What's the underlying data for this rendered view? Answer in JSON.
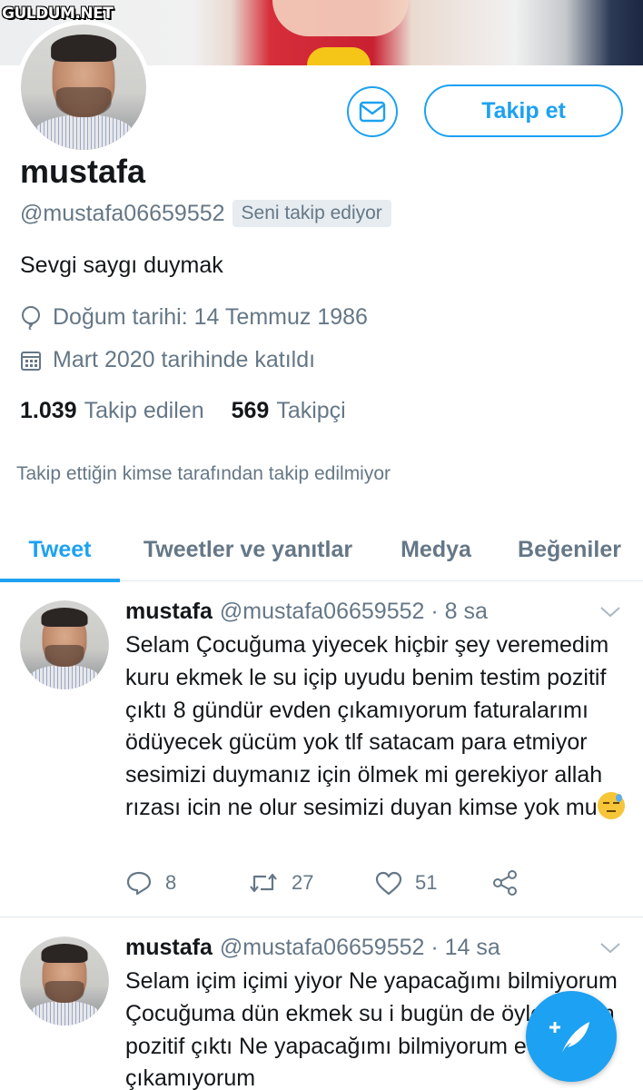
{
  "watermark": "GULDUM.NET",
  "profile": {
    "name": "mustafa",
    "handle": "@mustafa06659552",
    "follows_you": "Seni takip ediyor",
    "bio": "Sevgi saygı duymak",
    "birth": "Doğum tarihi: 14 Temmuz 1986",
    "joined": "Mart 2020 tarihinde katıldı",
    "following_count": "1.039",
    "following_label": "Takip edilen",
    "followers_count": "569",
    "followers_label": "Takipçi",
    "not_followed_note": "Takip ettiğin kimse tarafından takip edilmiyor",
    "follow_button": "Takip et",
    "message_icon": "mail-icon"
  },
  "tabs": [
    {
      "label": "Tweet",
      "active": true
    },
    {
      "label": "Tweetler ve yanıtlar",
      "active": false
    },
    {
      "label": "Medya",
      "active": false
    },
    {
      "label": "Beğeniler",
      "active": false
    }
  ],
  "tweets": [
    {
      "name": "mustafa",
      "handle": "@mustafa06659552",
      "time": "· 8 sa",
      "text": "Selam Çocuğuma yiyecek hiçbir şey veremedim kuru ekmek le su içip uyudu benim testim pozitif çıktı 8 gündür evden çıkamıyorum faturalarımı ödüyecek gücüm yok tlf satacam para etmiyor sesimizi duymanız için ölmek mi gerekiyor allah rızası icin ne olur sesimizi duyan kimse yok mu",
      "emoji": "downcast-face-with-sweat",
      "replies": "8",
      "retweets": "27",
      "likes": "51"
    },
    {
      "name": "mustafa",
      "handle": "@mustafa06659552",
      "time": "· 14 sa",
      "text": "Selam içim içimi yiyor Ne yapacağımı bilmiyorum Çocuğuma dün ekmek su i bugün de öyle Testim pozitif çıktı Ne yapacağımı bilmiyorum evden çıkamıyorum"
    }
  ],
  "colors": {
    "accent": "#1da1f2",
    "secondary_text": "#657786",
    "divider": "#e1e8ed"
  }
}
